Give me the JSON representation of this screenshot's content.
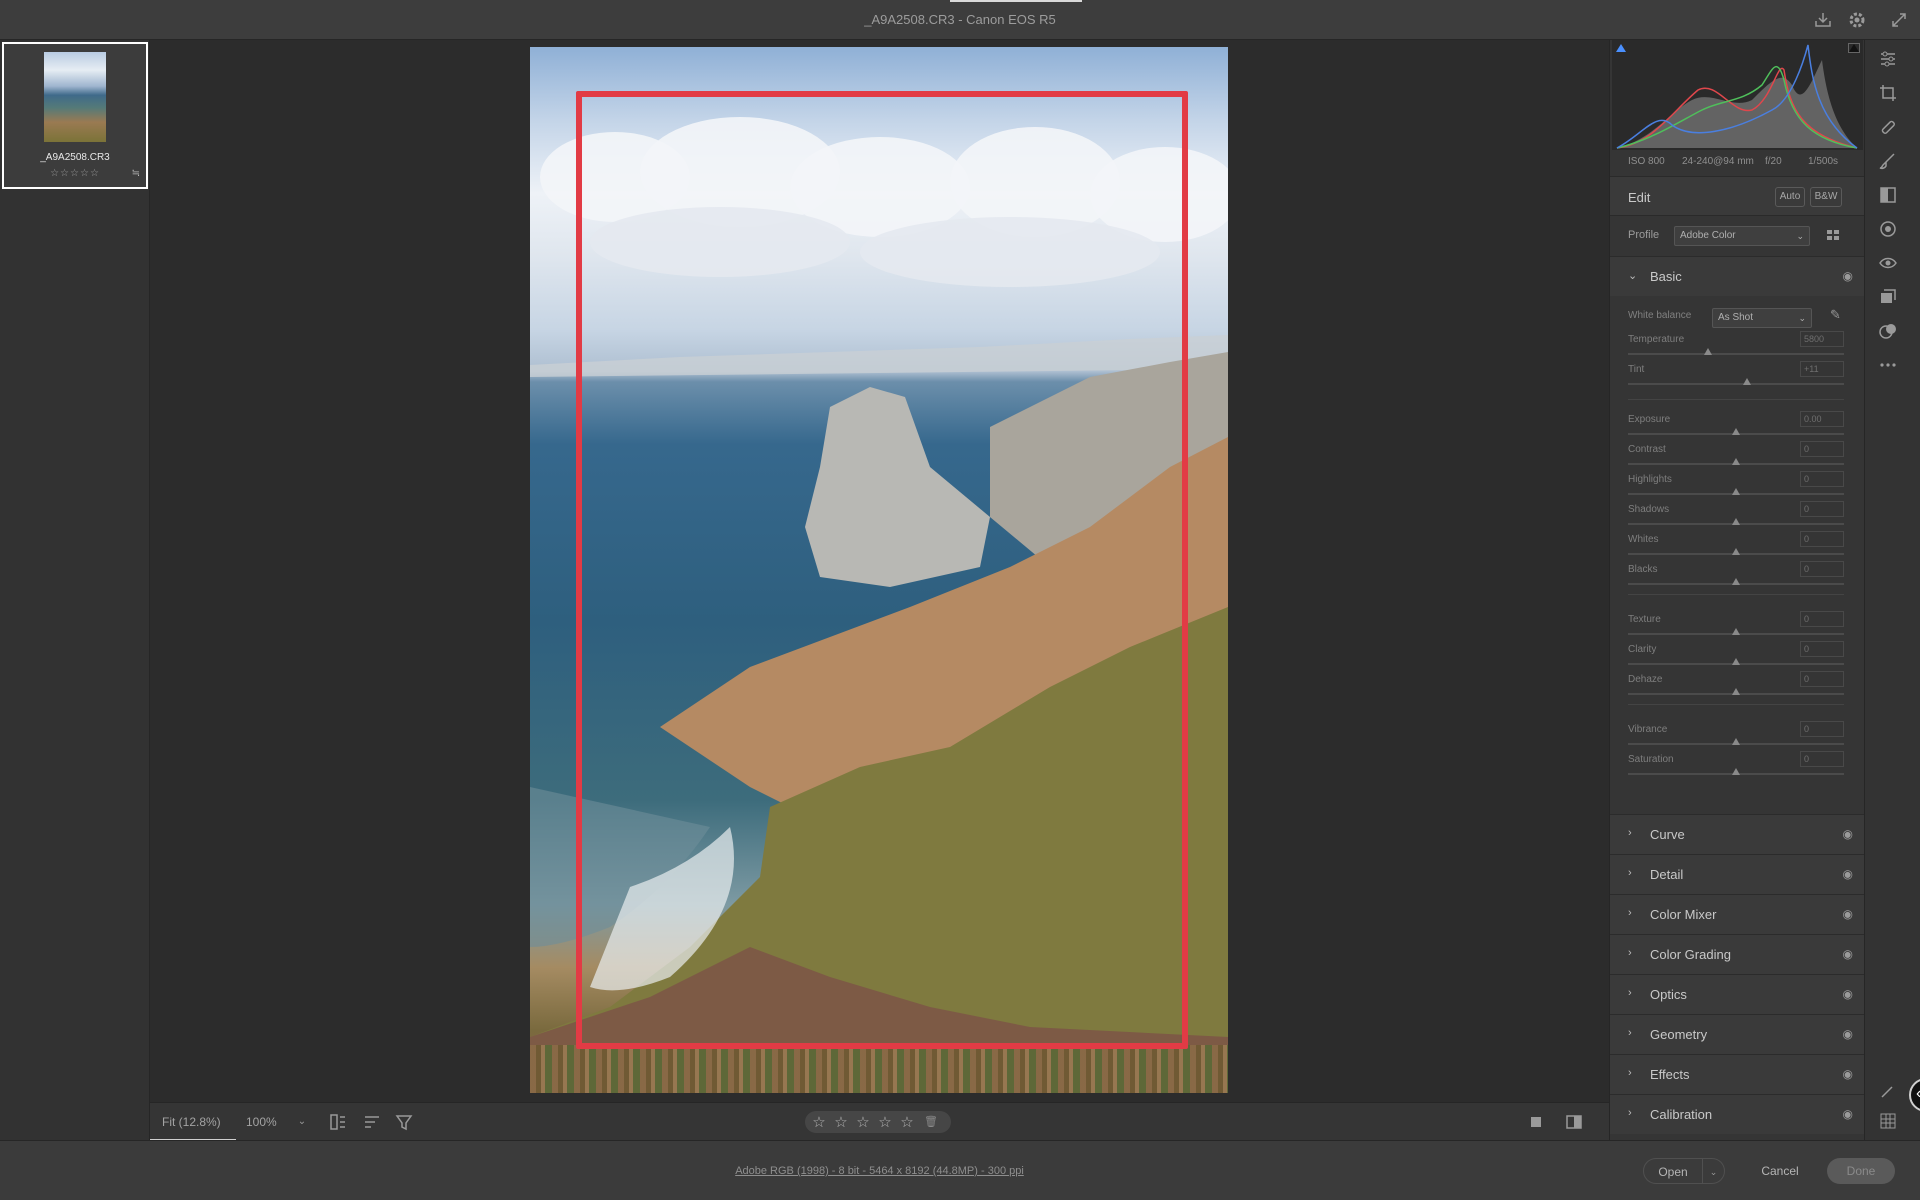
{
  "window": {
    "title": "_A9A2508.CR3  -  Canon EOS R5"
  },
  "filmstrip": {
    "items": [
      {
        "filename": "_A9A2508.CR3",
        "rating": "☆☆☆☆☆"
      }
    ]
  },
  "canvas_toolbar": {
    "fit_label": "Fit (12.8%)",
    "zoom_label": "100%",
    "zoom_dropdown": "⌄",
    "rating_stars": [
      "☆",
      "☆",
      "☆",
      "☆",
      "☆"
    ],
    "trash_glyph": "🗑"
  },
  "annotation": {
    "color": "#e23b45"
  },
  "statusbar": {
    "file_info": "Adobe RGB (1998) - 8 bit - 5464 x 8192 (44.8MP) - 300 ppi",
    "open_label": "Open",
    "open_dropdown": "⌄",
    "cancel_label": "Cancel",
    "done_label": "Done"
  },
  "histogram": {
    "metadata": [
      "ISO 800",
      "24-240@94 mm",
      "f/20",
      "1/500s"
    ],
    "colors": {
      "red": "#e0474c",
      "green": "#4fbf5b",
      "blue": "#4a7fe0",
      "luma": "#cfcfcf"
    }
  },
  "edit": {
    "title": "Edit",
    "auto_label": "Auto",
    "bw_label": "B&W",
    "profile_label": "Profile",
    "profile_value": "Adobe Color",
    "basic": {
      "title": "Basic",
      "white_balance_label": "White balance",
      "white_balance_value": "As Shot",
      "sliders": [
        {
          "label": "Temperature",
          "value": "5800",
          "position": 0.37
        },
        {
          "label": "Tint",
          "value": "+11",
          "position": 0.55
        },
        {
          "label": "Exposure",
          "value": "0.00",
          "position": 0.5
        },
        {
          "label": "Contrast",
          "value": "0",
          "position": 0.5
        },
        {
          "label": "Highlights",
          "value": "0",
          "position": 0.5
        },
        {
          "label": "Shadows",
          "value": "0",
          "position": 0.5
        },
        {
          "label": "Whites",
          "value": "0",
          "position": 0.5
        },
        {
          "label": "Blacks",
          "value": "0",
          "position": 0.5
        },
        {
          "label": "Texture",
          "value": "0",
          "position": 0.5
        },
        {
          "label": "Clarity",
          "value": "0",
          "position": 0.5
        },
        {
          "label": "Dehaze",
          "value": "0",
          "position": 0.5
        },
        {
          "label": "Vibrance",
          "value": "0",
          "position": 0.5
        },
        {
          "label": "Saturation",
          "value": "0",
          "position": 0.5
        }
      ]
    },
    "sections": [
      "Curve",
      "Detail",
      "Color Mixer",
      "Color Grading",
      "Optics",
      "Geometry",
      "Effects",
      "Calibration"
    ]
  },
  "icons": {
    "chevron_down": "⌄",
    "chevron_right": "›",
    "eye": "◉",
    "eyedropper": "✎",
    "caret": "▾",
    "collapse": "‹"
  }
}
